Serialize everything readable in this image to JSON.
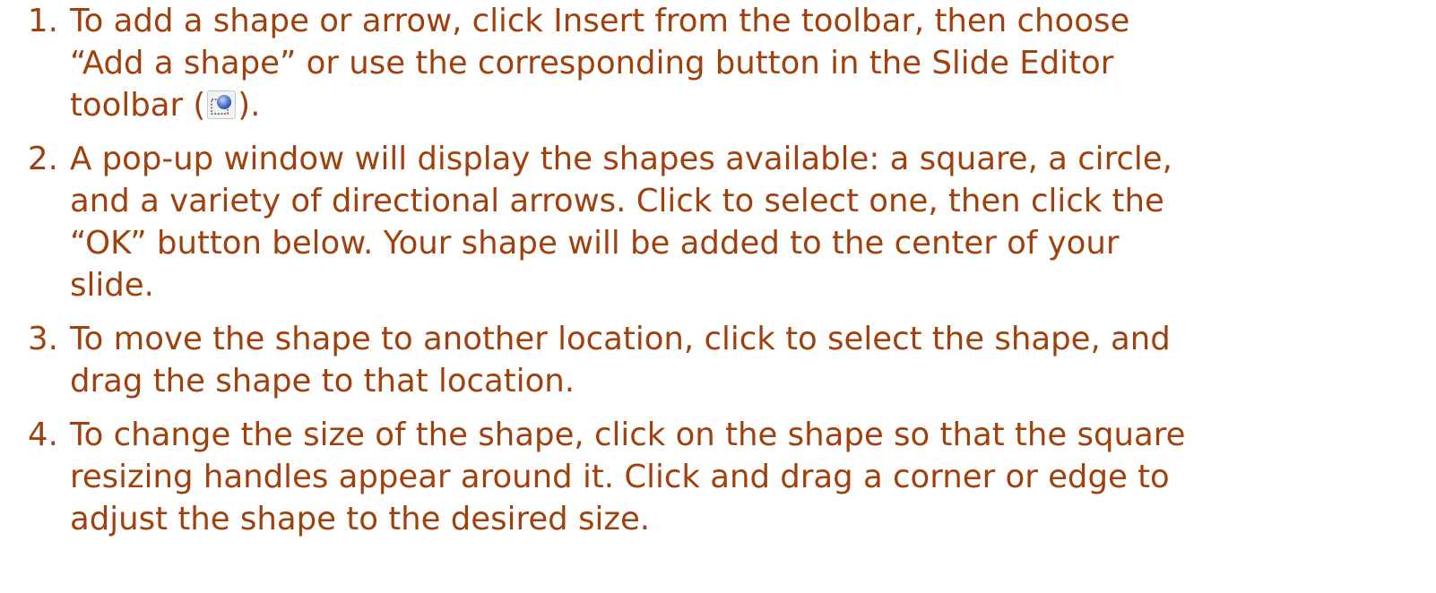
{
  "steps": [
    {
      "number": "1.",
      "text_before": "To add a shape or arrow, click Insert from the toolbar, then choose\n“Add a shape” or use the corresponding button in the Slide Editor\ntoolbar (",
      "icon": "add-shape-icon",
      "text_after": ")."
    },
    {
      "number": "2.",
      "text": "A pop-up window will display the shapes available: a square, a circle,\nand a variety of directional arrows.  Click to select one, then click the\n“OK” button below.  Your shape will be added to the center of your\nslide."
    },
    {
      "number": "3.",
      "text": "To move the shape to another location, click to select the shape, and\ndrag the shape to that location."
    },
    {
      "number": "4.",
      "text": "To change the size of the shape, click on the shape so that the square\nresizing handles appear around it.  Click and drag a corner or edge to\nadjust the shape to the desired size."
    }
  ],
  "colors": {
    "text": "#a0410d",
    "background": "#ffffff"
  }
}
